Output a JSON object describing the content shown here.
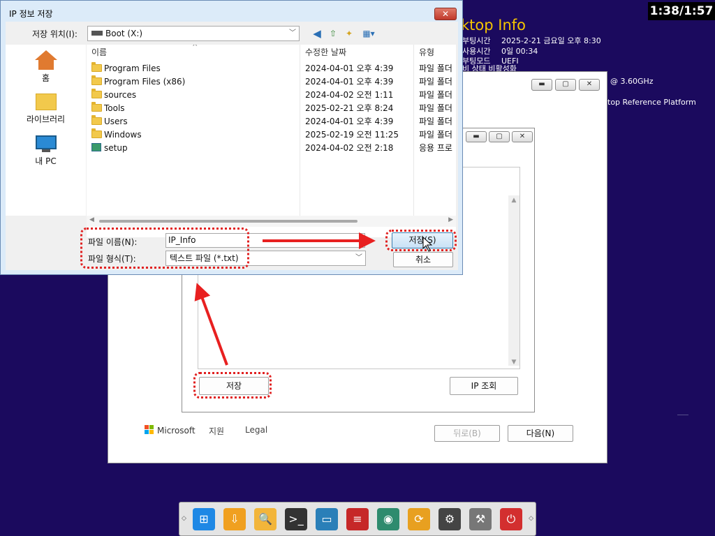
{
  "clock": "1:38/1:57",
  "desktop_info": {
    "title": "ktop Info",
    "rows": [
      {
        "k": "부팅시간",
        "v": "2025-2-21 금요일 오후 8:30"
      },
      {
        "k": "사용시간",
        "v": "0일 00:34"
      },
      {
        "k": "부팅모드",
        "v": "UEFI"
      }
    ],
    "cut_row": "비 상태      비활성화",
    "cpu": "@ 3.60GHz",
    "board": "top Reference Platform"
  },
  "wizard": {
    "footer": {
      "microsoft": "Microsoft",
      "support": "지원",
      "legal": "Legal"
    },
    "back_label": "뒤로(B)",
    "next_label": "다음(N)",
    "inner": {
      "save_label": "저장",
      "ip_lookup_label": "IP 조회"
    }
  },
  "dialog": {
    "title": "IP 정보 저장",
    "close_glyph": "✕",
    "location_label": "저장 위치(I):",
    "location_value": "Boot (X:)",
    "places": [
      {
        "label": "홈",
        "icon": "home-icon"
      },
      {
        "label": "라이브러리",
        "icon": "library-folder-icon"
      },
      {
        "label": "내 PC",
        "icon": "computer-monitor-icon"
      }
    ],
    "columns": {
      "name": "이름",
      "modified": "수정한 날짜",
      "type": "유형"
    },
    "files": [
      {
        "name": "Program Files",
        "date": "2024-04-01 오후 4:39",
        "type": "파일 폴더",
        "icon": "folder"
      },
      {
        "name": "Program Files (x86)",
        "date": "2024-04-01 오후 4:39",
        "type": "파일 폴더",
        "icon": "folder"
      },
      {
        "name": "sources",
        "date": "2024-04-02 오전 1:11",
        "type": "파일 폴더",
        "icon": "folder"
      },
      {
        "name": "Tools",
        "date": "2025-02-21 오후 8:24",
        "type": "파일 폴더",
        "icon": "folder"
      },
      {
        "name": "Users",
        "date": "2024-04-01 오후 4:39",
        "type": "파일 폴더",
        "icon": "folder"
      },
      {
        "name": "Windows",
        "date": "2025-02-19 오전 11:25",
        "type": "파일 폴더",
        "icon": "folder"
      },
      {
        "name": "setup",
        "date": "2024-04-02 오전 2:18",
        "type": "응용 프로",
        "icon": "setup-app"
      }
    ],
    "filename_label": "파일 이름(N):",
    "filename_value": "IP_Info",
    "filetype_label": "파일 형식(T):",
    "filetype_value": "텍스트 파일 (*.txt)",
    "save_label": "저장(S)",
    "cancel_label": "취소"
  },
  "taskbar": {
    "apps": [
      {
        "name": "windows-start-icon",
        "glyph": "⊞",
        "color": "#1e88e5"
      },
      {
        "name": "usb-drive-icon",
        "glyph": "⇩",
        "color": "#f0a020"
      },
      {
        "name": "file-explorer-icon",
        "glyph": "🔍",
        "color": "#f2b53a"
      },
      {
        "name": "command-prompt-icon",
        "glyph": ">_",
        "color": "#333333"
      },
      {
        "name": "monitor-icon",
        "glyph": "▭",
        "color": "#2a7fb8"
      },
      {
        "name": "disk-partition-icon",
        "glyph": "≡",
        "color": "#c62828"
      },
      {
        "name": "disk-tool-icon",
        "glyph": "◉",
        "color": "#2e8b6e"
      },
      {
        "name": "sync-icon",
        "glyph": "⟳",
        "color": "#e8a020"
      },
      {
        "name": "settings-gear-icon",
        "glyph": "⚙",
        "color": "#444444"
      },
      {
        "name": "tools-hammer-icon",
        "glyph": "⚒",
        "color": "#777777"
      },
      {
        "name": "power-icon",
        "glyph": "⏻",
        "color": "#d32f2f"
      }
    ],
    "left_grip": "◇",
    "right_grip": "◇"
  },
  "colors": {
    "desktop": "#1b0a5e",
    "highlight": "#e02020",
    "accent_title": "#f5c400"
  }
}
